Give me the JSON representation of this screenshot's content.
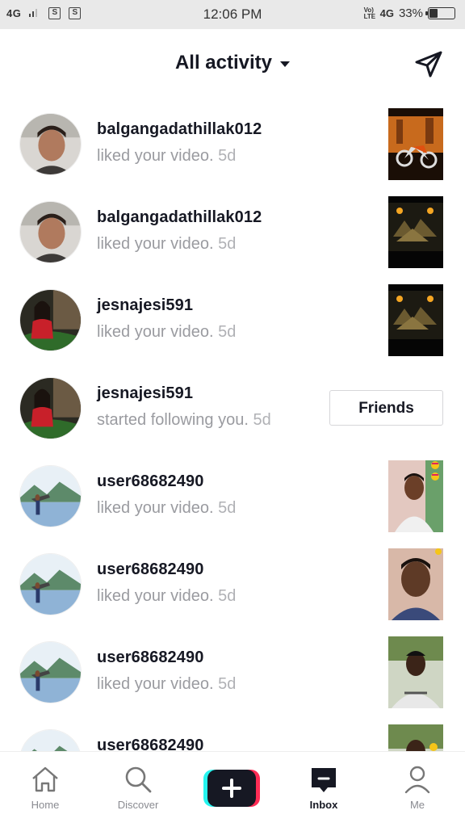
{
  "status_bar": {
    "signal": "4G",
    "time": "12:06 PM",
    "volte": "Vo) LTE",
    "network": "4G",
    "battery": "33%",
    "battery_level": 0.33
  },
  "header": {
    "title": "All activity"
  },
  "notifications": [
    {
      "username": "balgangadathillak012",
      "action": "liked your video.",
      "time": "5d"
    },
    {
      "username": "balgangadathillak012",
      "action": "liked your video.",
      "time": "5d"
    },
    {
      "username": "jesnajesi591",
      "action": "liked your video.",
      "time": "5d"
    },
    {
      "username": "jesnajesi591",
      "action": "started following you.",
      "time": "5d",
      "button": "Friends"
    },
    {
      "username": "user68682490",
      "action": "liked your video.",
      "time": "5d"
    },
    {
      "username": "user68682490",
      "action": "liked your video.",
      "time": "5d"
    },
    {
      "username": "user68682490",
      "action": "liked your video.",
      "time": "5d"
    },
    {
      "username": "user68682490"
    }
  ],
  "nav": {
    "home": "Home",
    "discover": "Discover",
    "inbox": "Inbox",
    "me": "Me"
  },
  "colors": {
    "accent_cyan": "#25f4ee",
    "accent_red": "#fe2c55",
    "text_primary": "#161823",
    "text_secondary": "#9a9ba0"
  }
}
